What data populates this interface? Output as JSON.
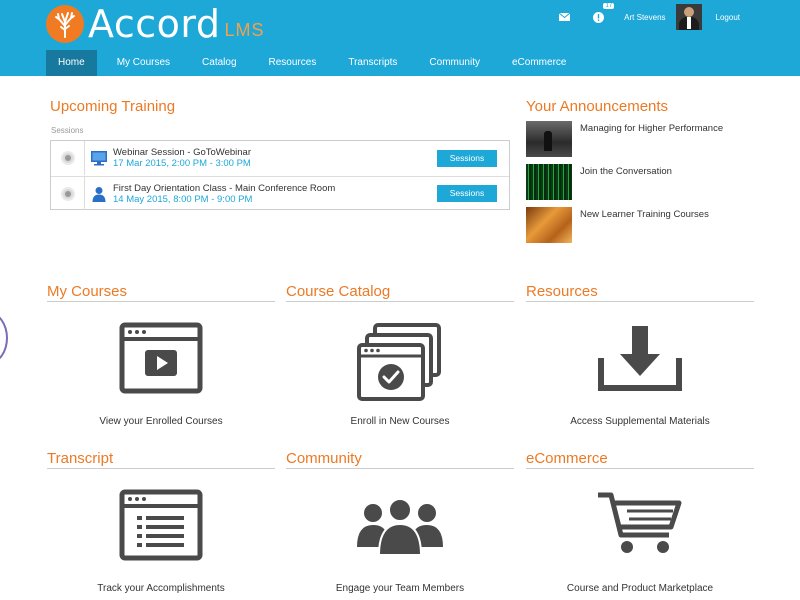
{
  "header": {
    "logo_text": "Accord",
    "logo_suffix": "LMS",
    "notification_count": "17",
    "user_name": "Art Stevens",
    "logout_label": "Logout"
  },
  "nav": {
    "items": [
      "Home",
      "My Courses",
      "Catalog",
      "Resources",
      "Transcripts",
      "Community",
      "eCommerce"
    ]
  },
  "upcoming": {
    "title": "Upcoming Training",
    "sessions_label": "Sessions",
    "rows": [
      {
        "title": "Webinar Session - GoToWebinar",
        "date": "17 Mar 2015, 2:00 PM - 3:00 PM",
        "button": "Sessions"
      },
      {
        "title": "First Day Orientation Class - Main Conference Room",
        "date": "14 May 2015, 8:00 PM - 9:00 PM",
        "button": "Sessions"
      }
    ]
  },
  "announcements": {
    "title": "Your Announcements",
    "items": [
      {
        "text": "Managing for Higher Performance"
      },
      {
        "text": "Join the Conversation"
      },
      {
        "text": "New Learner Training Courses"
      }
    ]
  },
  "tiles": [
    {
      "title": "My Courses",
      "caption": "View your Enrolled Courses",
      "icon": "video-window-icon"
    },
    {
      "title": "Course Catalog",
      "caption": "Enroll in New Courses",
      "icon": "catalog-check-icon"
    },
    {
      "title": "Resources",
      "caption": "Access Supplemental Materials",
      "icon": "download-icon"
    },
    {
      "title": "Transcript",
      "caption": "Track your Accomplishments",
      "icon": "document-list-icon"
    },
    {
      "title": "Community",
      "caption": "Engage your Team Members",
      "icon": "team-icon"
    },
    {
      "title": "eCommerce",
      "caption": "Course and Product Marketplace",
      "icon": "cart-icon"
    }
  ],
  "colors": {
    "header_bg": "#1da8d8",
    "nav_active": "#18799f",
    "accent_orange": "#ec7a25",
    "icon_gray": "#4a4a4a"
  }
}
